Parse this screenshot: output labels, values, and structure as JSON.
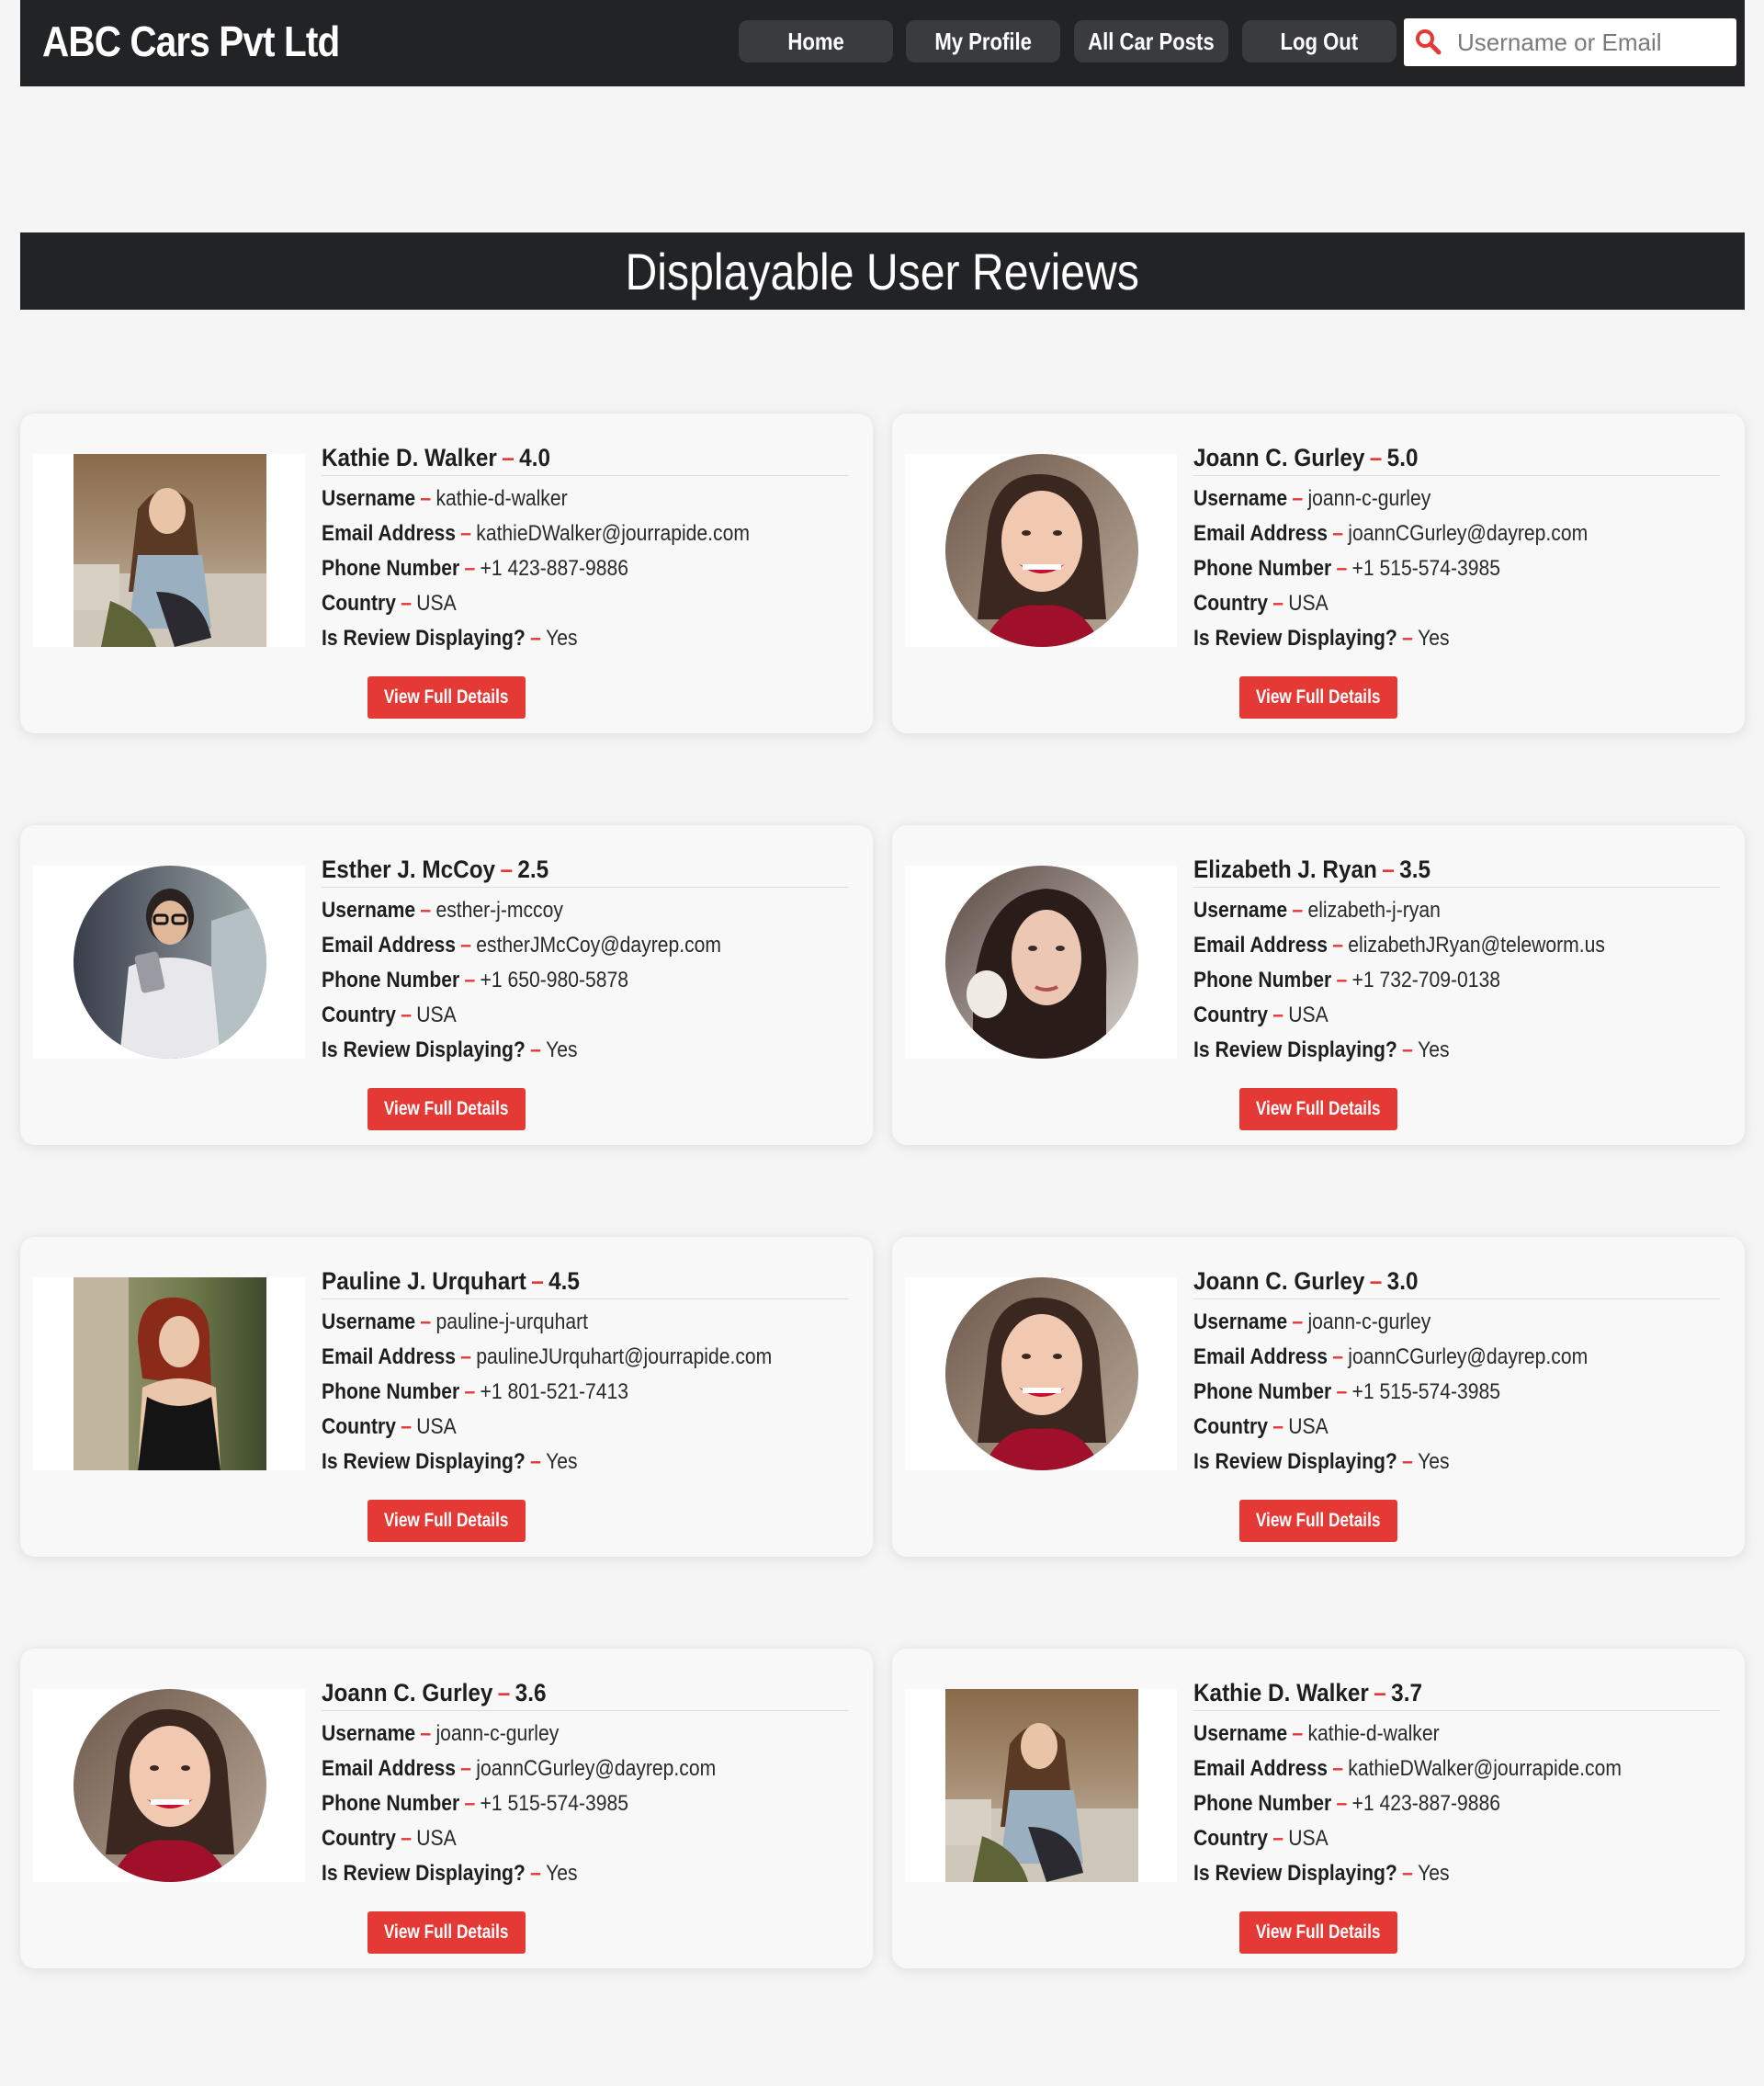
{
  "brand": "ABC Cars Pvt Ltd",
  "nav": {
    "items": [
      "Home",
      "My Profile",
      "All Car Posts",
      "Log Out"
    ],
    "search_placeholder": "Username or Email"
  },
  "page_title": "Displayable User Reviews",
  "labels": {
    "username": "Username",
    "email": "Email Address",
    "phone": "Phone Number",
    "country": "Country",
    "displaying": "Is Review Displaying?",
    "dash": "–",
    "button": "View Full Details"
  },
  "colors": {
    "accent": "#e53935",
    "dark_bar": "#222325",
    "nav_button": "#3a3b3f",
    "background": "#f5f5f5"
  },
  "reviews": [
    {
      "name": "Kathie D. Walker",
      "rating": "4.0",
      "username": "kathie-d-walker",
      "email": "kathieDWalker@jourrapide.com",
      "phone": "+1 423-887-9886",
      "country": "USA",
      "displaying": "Yes",
      "photo": "kathie-photo"
    },
    {
      "name": "Joann C. Gurley",
      "rating": "5.0",
      "username": "joann-c-gurley",
      "email": "joannCGurley@dayrep.com",
      "phone": "+1 515-574-3985",
      "country": "USA",
      "displaying": "Yes",
      "photo": "joann-photo"
    },
    {
      "name": "Esther J. McCoy",
      "rating": "2.5",
      "username": "esther-j-mccoy",
      "email": "estherJMcCoy@dayrep.com",
      "phone": "+1 650-980-5878",
      "country": "USA",
      "displaying": "Yes",
      "photo": "esther-photo"
    },
    {
      "name": "Elizabeth J. Ryan",
      "rating": "3.5",
      "username": "elizabeth-j-ryan",
      "email": "elizabethJRyan@teleworm.us",
      "phone": "+1 732-709-0138",
      "country": "USA",
      "displaying": "Yes",
      "photo": "elizabeth-photo"
    },
    {
      "name": "Pauline J. Urquhart",
      "rating": "4.5",
      "username": "pauline-j-urquhart",
      "email": "paulineJUrquhart@jourrapide.com",
      "phone": "+1 801-521-7413",
      "country": "USA",
      "displaying": "Yes",
      "photo": "pauline-photo"
    },
    {
      "name": "Joann C. Gurley",
      "rating": "3.0",
      "username": "joann-c-gurley",
      "email": "joannCGurley@dayrep.com",
      "phone": "+1 515-574-3985",
      "country": "USA",
      "displaying": "Yes",
      "photo": "joann-photo"
    },
    {
      "name": "Joann C. Gurley",
      "rating": "3.6",
      "username": "joann-c-gurley",
      "email": "joannCGurley@dayrep.com",
      "phone": "+1 515-574-3985",
      "country": "USA",
      "displaying": "Yes",
      "photo": "joann-photo"
    },
    {
      "name": "Kathie D. Walker",
      "rating": "3.7",
      "username": "kathie-d-walker",
      "email": "kathieDWalker@jourrapide.com",
      "phone": "+1 423-887-9886",
      "country": "USA",
      "displaying": "Yes",
      "photo": "kathie-photo"
    }
  ]
}
